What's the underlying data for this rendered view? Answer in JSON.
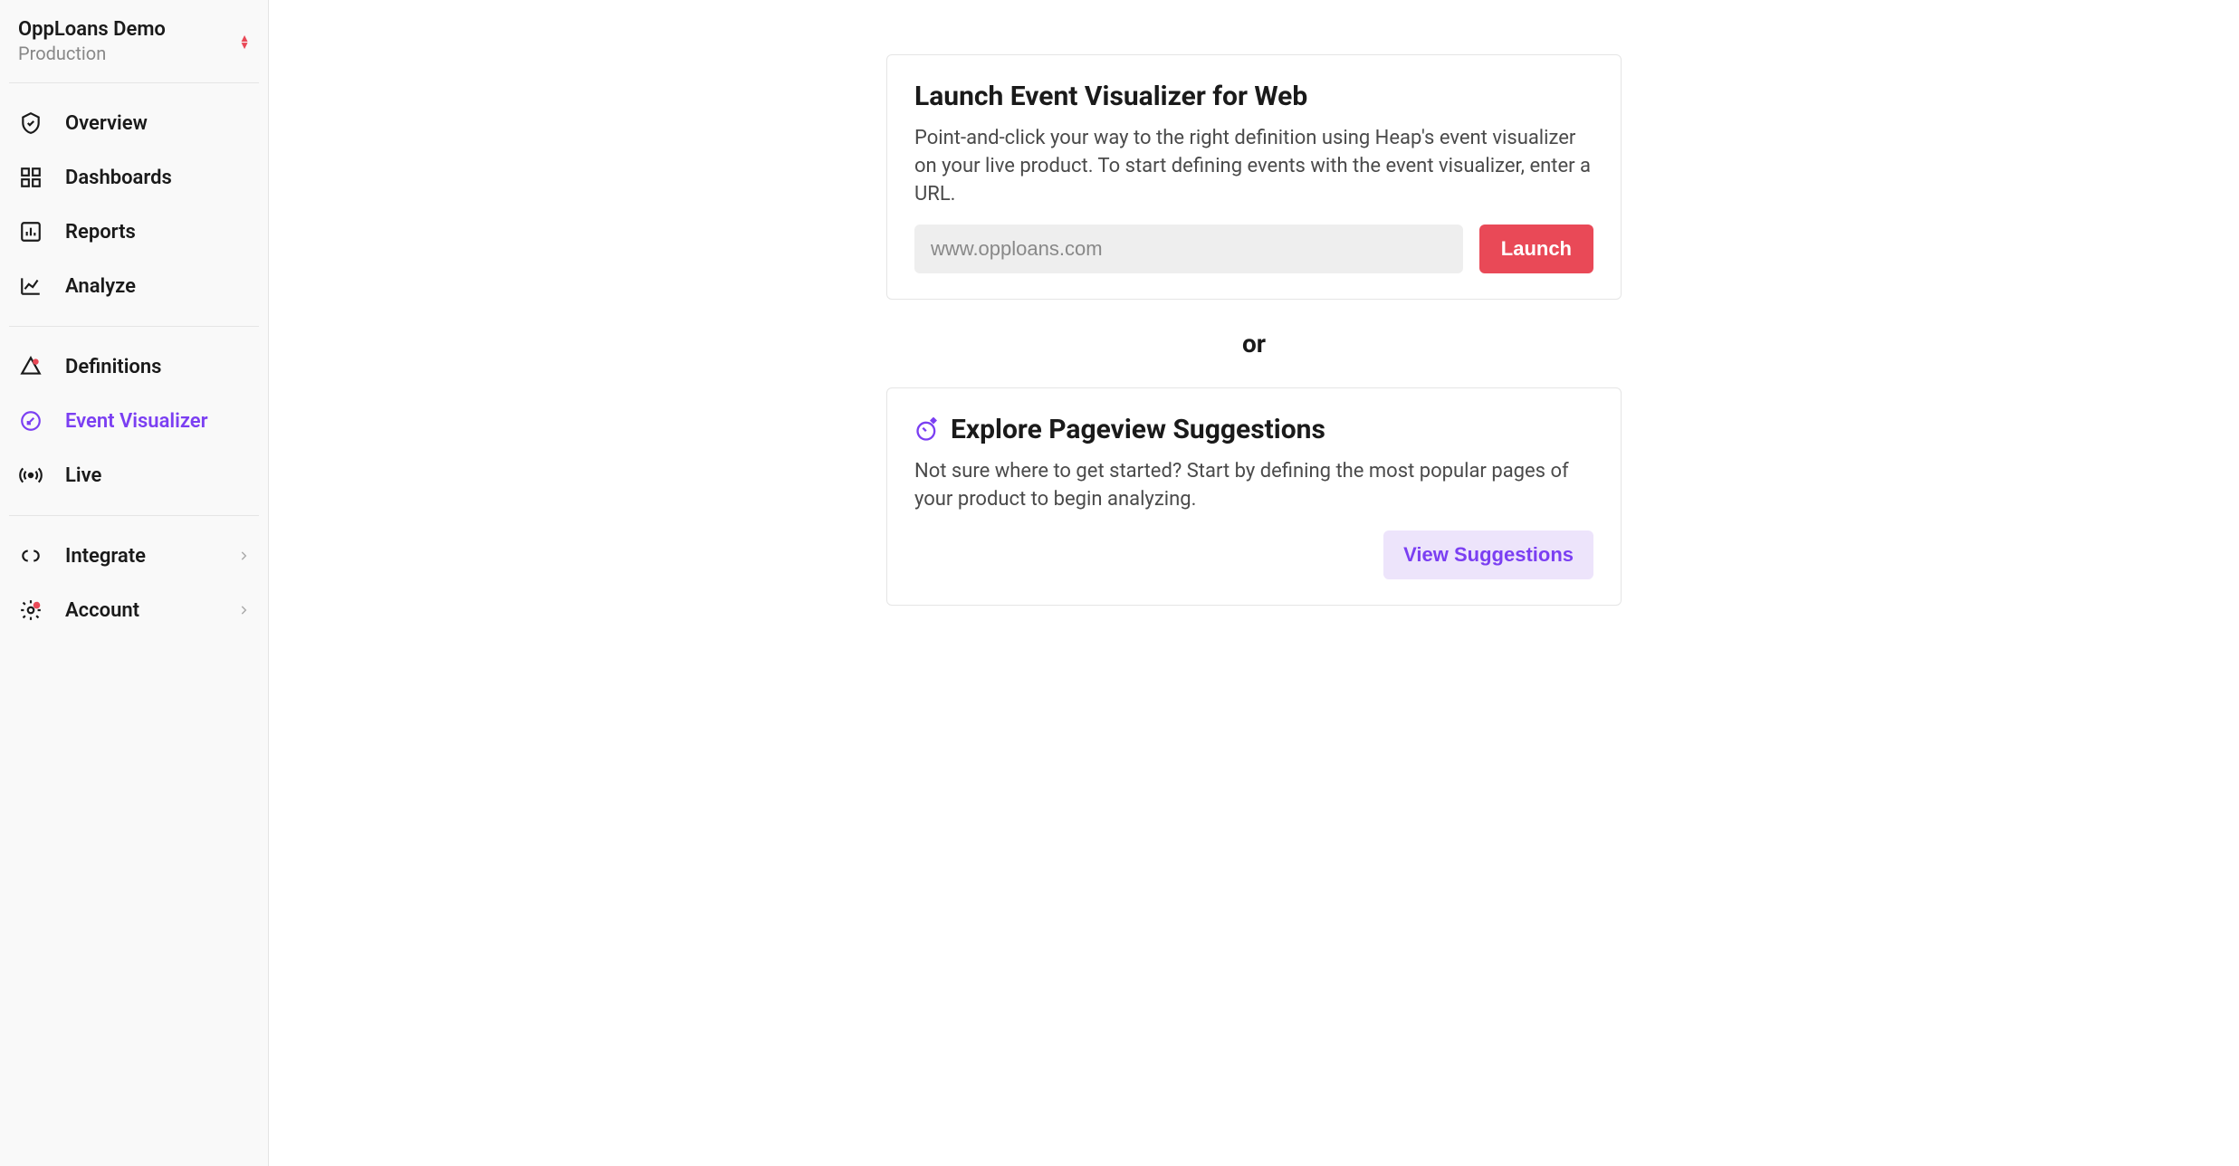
{
  "org": {
    "name": "OppLoans Demo",
    "env": "Production"
  },
  "nav": {
    "overview": "Overview",
    "dashboards": "Dashboards",
    "reports": "Reports",
    "analyze": "Analyze",
    "definitions": "Definitions",
    "event_visualizer": "Event Visualizer",
    "live": "Live",
    "integrate": "Integrate",
    "account": "Account"
  },
  "launch_card": {
    "title": "Launch Event Visualizer for Web",
    "desc": "Point-and-click your way to the right definition using Heap's event visualizer on your live product. To start defining events with the event visualizer, enter a URL.",
    "placeholder": "www.opploans.com",
    "button": "Launch"
  },
  "separator": "or",
  "suggestions_card": {
    "title": "Explore Pageview Suggestions",
    "desc": "Not sure where to get started? Start by defining the most popular pages of your product to begin analyzing.",
    "button": "View Suggestions"
  }
}
